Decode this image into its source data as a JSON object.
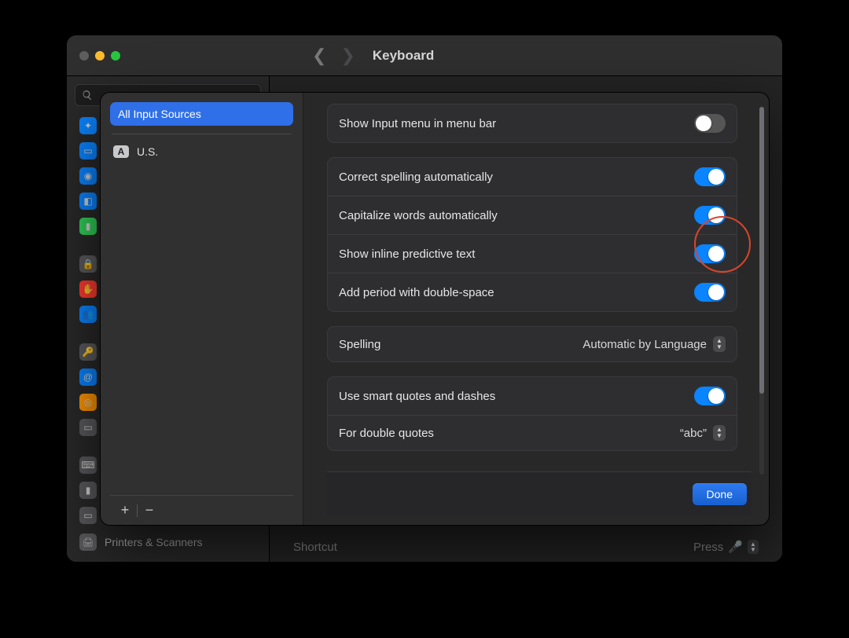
{
  "window": {
    "title": "Keyboard"
  },
  "sidebar": {
    "bottom_item": "Printers & Scanners"
  },
  "main_under": {
    "footer_left": "Shortcut",
    "footer_right": "Press"
  },
  "sheet": {
    "all_label": "All Input Sources",
    "source_badge": "A",
    "source_name": "U.S.",
    "settings": {
      "show_input_menu": {
        "label": "Show Input menu in menu bar",
        "on": false
      },
      "correct_spelling": {
        "label": "Correct spelling automatically",
        "on": true
      },
      "capitalize": {
        "label": "Capitalize words automatically",
        "on": true
      },
      "predictive": {
        "label": "Show inline predictive text",
        "on": true,
        "highlighted": true
      },
      "add_period": {
        "label": "Add period with double-space",
        "on": true
      },
      "spelling": {
        "label": "Spelling",
        "value": "Automatic by Language"
      },
      "smart_quotes": {
        "label": "Use smart quotes and dashes",
        "on": true
      },
      "double_quotes": {
        "label": "For double quotes",
        "value": "“abc”"
      }
    },
    "done": "Done"
  }
}
